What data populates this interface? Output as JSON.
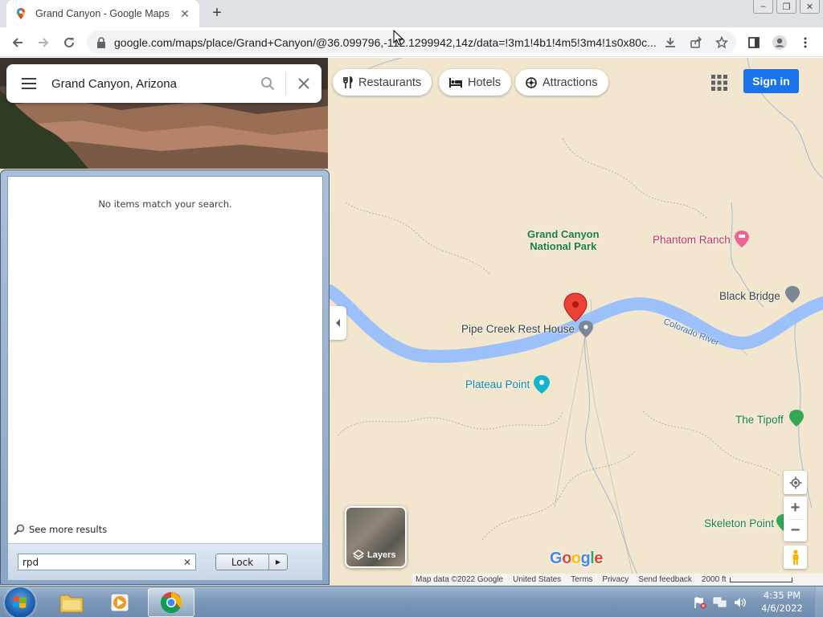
{
  "browser": {
    "tab": {
      "title": "Grand Canyon - Google Maps",
      "close_glyph": "✕"
    },
    "new_tab_glyph": "+",
    "window_controls": {
      "minimize": "–",
      "restore": "❐",
      "close": "✕"
    },
    "url": "google.com/maps/place/Grand+Canyon/@36.099796,-112.1299942,14z/data=!3m1!4b1!4m5!3m4!1s0x80c..."
  },
  "maps": {
    "search": {
      "query": "Grand Canyon, Arizona"
    },
    "chips": [
      {
        "label": "Restaurants"
      },
      {
        "label": "Hotels"
      },
      {
        "label": "Attractions"
      }
    ],
    "sign_in": "Sign in",
    "places": {
      "park": [
        "Grand Canyon",
        "National Park"
      ],
      "phantom_ranch": "Phantom Ranch",
      "black_bridge": "Black Bridge",
      "pipe_creek": "Pipe Creek Rest House",
      "river": "Colorado River",
      "plateau_point": "Plateau Point",
      "the_tipoff": "The Tipoff",
      "skeleton_point": "Skeleton Point"
    },
    "layers_label": "Layers",
    "logo": "Google",
    "footer": {
      "map_data": "Map data ©2022 Google",
      "region": "United States",
      "terms": "Terms",
      "privacy": "Privacy",
      "feedback": "Send feedback",
      "scale": "2000 ft"
    },
    "controls": {
      "zoom_in": "+",
      "zoom_out": "−"
    }
  },
  "start_menu": {
    "no_results": "No items match your search.",
    "see_more": "See more results",
    "search_value": "rpd",
    "clear_glyph": "✕",
    "lock_label": "Lock",
    "lock_arrow": "▶"
  },
  "taskbar": {
    "time": "4:35 PM",
    "date": "4/6/2022"
  },
  "colors": {
    "map_bg": "#f2e6cf",
    "river": "#9cc0f9",
    "park_green": "#188038",
    "signin_blue": "#1a73e8",
    "pin_red": "#ea4335"
  }
}
